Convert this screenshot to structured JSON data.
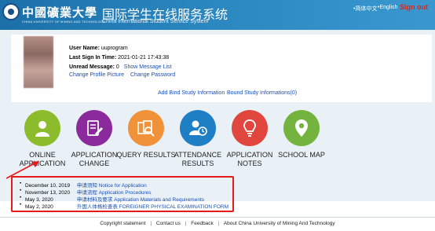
{
  "header": {
    "school_name_cn": "中國礦業大學",
    "school_name_en": "CHINA UNIVERSITY OF MINING AND TECHNOLOGY",
    "title_cn": "国际学生在线服务系统",
    "title_en": "China International Student Service System",
    "lang_cn": "•简体中文",
    "lang_en": "•English",
    "sign_out": "Sign out"
  },
  "user": {
    "username_label": "User Name:",
    "username": "uuprogram",
    "last_sign_in_label": "Last Sign In Time:",
    "last_sign_in": "2021-01-21 17:43:38",
    "unread_label": "Unread Message:",
    "unread_count": "0",
    "show_messages": "Show Message List",
    "change_picture": "Change Profile Picture",
    "change_password": "Change Password"
  },
  "bind_links": {
    "add": "Add Bind Study Information",
    "bound": "Bound Study Informations(0)"
  },
  "tiles": [
    {
      "label": "ONLINE APPLICATION",
      "color": "#8cbb2c",
      "icon": "person-icon"
    },
    {
      "label": "APPLICATION CHANGE",
      "color": "#8a2a9c",
      "icon": "edit-document-icon"
    },
    {
      "label": "QUERY RESULTS",
      "color": "#f0923a",
      "icon": "search-documents-icon"
    },
    {
      "label": "ATTENDANCE RESULTS",
      "color": "#1f7fc4",
      "icon": "person-clock-icon"
    },
    {
      "label": "APPLICATION NOTES",
      "color": "#e0463d",
      "icon": "lightbulb-icon"
    },
    {
      "label": "SCHOOL MAP",
      "color": "#75b33f",
      "icon": "map-pin-icon"
    }
  ],
  "notices": [
    {
      "date": "December 10, 2019",
      "title": "申请须知 Notice for Application"
    },
    {
      "date": "November 13, 2020",
      "title": "申请流程 Application Procedures"
    },
    {
      "date": "May 3, 2020",
      "title": "申请材料及要求 Application Materials and Requirements"
    },
    {
      "date": "May 2, 2020",
      "title": "外国人体格检查表 FOREIGNER PHYSICAL EXAMINATION FORM"
    }
  ],
  "footer": {
    "copyright": "Copyright statement",
    "contact": "Contact us",
    "feedback": "Feedback",
    "about": "About China University of Mining And Technology"
  },
  "colors": {
    "header": "#2a86bf",
    "panel": "#eaf1f6",
    "link": "#1a4fb3",
    "sign_out": "#e0261b",
    "annotation_red": "#e51b1b"
  }
}
